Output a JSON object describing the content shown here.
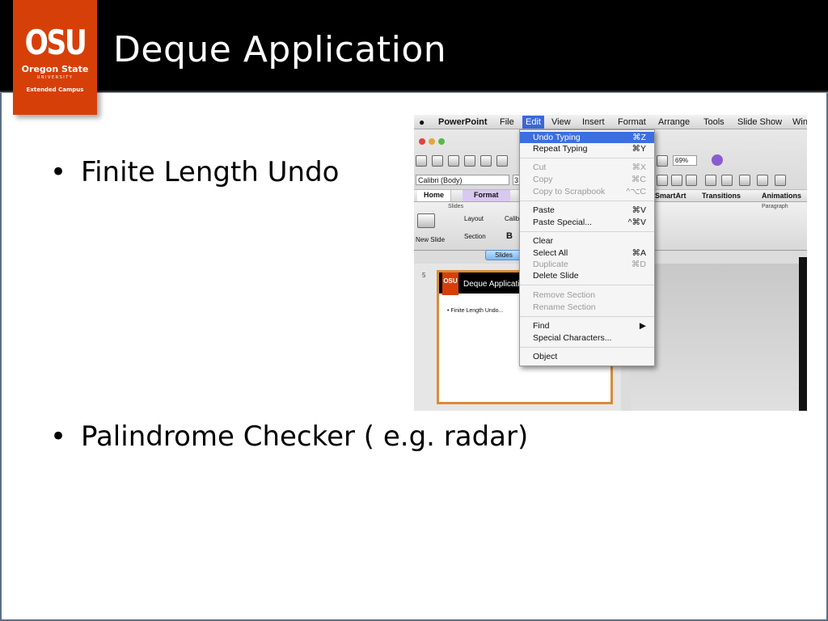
{
  "slide": {
    "title": "Deque Application",
    "logo": {
      "line_big": "OSU",
      "line1": "Oregon State",
      "line2": "UNIVERSITY",
      "line3": "Extended Campus"
    },
    "bullets": [
      "Finite Length Undo",
      "Palindrome Checker ( e.g. radar)"
    ],
    "bullet_symbol": "•"
  },
  "screenshot": {
    "menubar": {
      "apple": "",
      "app": "PowerPoint",
      "items": [
        "File",
        "Edit",
        "View",
        "Insert",
        "Format",
        "Arrange",
        "Tools",
        "Slide Show",
        "Win"
      ]
    },
    "zoom": "69%",
    "font_name": "Calibri (Body)",
    "font_size": "3",
    "ribbon_tabs": {
      "home": "Home",
      "format": "Format",
      "smartart": "SmartArt",
      "transitions": "Transitions",
      "animations": "Animations"
    },
    "ribbon_groups": {
      "slides": "Slides",
      "paragraph": "Paragraph",
      "new_slide": "New Slide",
      "layout": "Layout",
      "section": "Section",
      "calib": "Calib",
      "bold": "B"
    },
    "slides_tab": "Slides",
    "slide_number": "5",
    "thumb": {
      "logo": "OSU",
      "title": "Deque Applicatio",
      "bullet": "•  Finite Length Undo..."
    },
    "edit_menu": [
      {
        "label": "Undo Typing",
        "shortcut": "⌘Z",
        "state": "highlight"
      },
      {
        "label": "Repeat Typing",
        "shortcut": "⌘Y",
        "state": "enabled"
      },
      {
        "label": "Cut",
        "shortcut": "⌘X",
        "state": "disabled"
      },
      {
        "label": "Copy",
        "shortcut": "⌘C",
        "state": "disabled"
      },
      {
        "label": "Copy to Scrapbook",
        "shortcut": "^⌥C",
        "state": "disabled"
      },
      {
        "label": "Paste",
        "shortcut": "⌘V",
        "state": "enabled"
      },
      {
        "label": "Paste Special...",
        "shortcut": "^⌘V",
        "state": "enabled"
      },
      {
        "label": "Clear",
        "shortcut": "",
        "state": "enabled"
      },
      {
        "label": "Select All",
        "shortcut": "⌘A",
        "state": "enabled"
      },
      {
        "label": "Duplicate",
        "shortcut": "⌘D",
        "state": "disabled"
      },
      {
        "label": "Delete Slide",
        "shortcut": "",
        "state": "enabled"
      },
      {
        "label": "Remove Section",
        "shortcut": "",
        "state": "disabled"
      },
      {
        "label": "Rename Section",
        "shortcut": "",
        "state": "disabled"
      },
      {
        "label": "Find",
        "shortcut": "▶",
        "state": "enabled"
      },
      {
        "label": "Special Characters...",
        "shortcut": "",
        "state": "enabled"
      },
      {
        "label": "Object",
        "shortcut": "",
        "state": "enabled"
      }
    ],
    "colors": {
      "osu_orange": "#d73f09",
      "menu_highlight": "#3b6fe0"
    }
  }
}
